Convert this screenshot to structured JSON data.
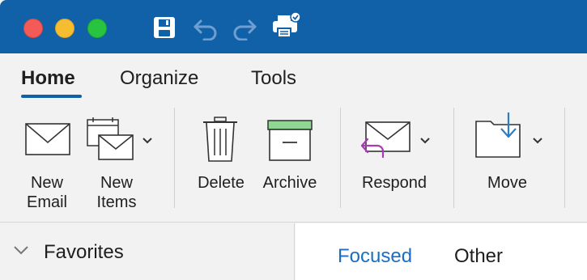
{
  "toolbar": {
    "icons": [
      "save-icon",
      "undo-icon",
      "redo-icon",
      "print-icon"
    ]
  },
  "tabs": [
    {
      "label": "Home",
      "active": true
    },
    {
      "label": "Organize",
      "active": false
    },
    {
      "label": "Tools",
      "active": false
    }
  ],
  "ribbon": {
    "new_email": "New\nEmail",
    "new_items": "New\nItems",
    "delete": "Delete",
    "archive": "Archive",
    "respond": "Respond",
    "move": "Move"
  },
  "sidebar": {
    "favorites_label": "Favorites"
  },
  "inbox_tabs": {
    "focused": "Focused",
    "other": "Other"
  },
  "colors": {
    "titlebar": "#1161a8",
    "accent": "#1161a8",
    "focused_text": "#1c6fc0",
    "respond_arrow": "#a93ab3",
    "archive_lid": "#8fd694"
  }
}
